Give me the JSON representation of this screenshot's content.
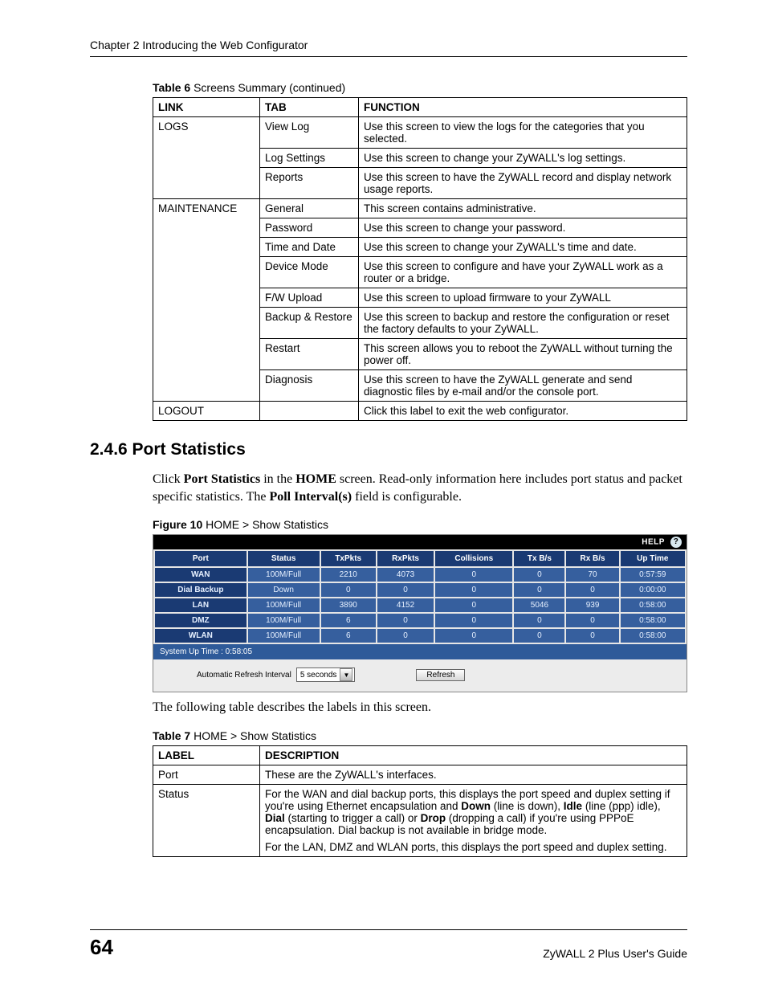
{
  "header": {
    "chapter": "Chapter 2 Introducing the Web Configurator"
  },
  "table6": {
    "caption_bold": "Table 6",
    "caption_rest": "   Screens Summary (continued)",
    "headers": {
      "link": "LINK",
      "tab": "TAB",
      "function": "FUNCTION"
    },
    "groups": [
      {
        "link": "LOGS",
        "rows": [
          {
            "tab": "View Log",
            "fn": "Use this screen to view the logs for the categories that you selected."
          },
          {
            "tab": "Log Settings",
            "fn": "Use this screen to change your ZyWALL's log settings."
          },
          {
            "tab": "Reports",
            "fn": "Use this screen to have the ZyWALL record and display network usage reports."
          }
        ]
      },
      {
        "link": "MAINTENANCE",
        "rows": [
          {
            "tab": "General",
            "fn": "This screen contains administrative."
          },
          {
            "tab": "Password",
            "fn": "Use this screen to change your password."
          },
          {
            "tab": "Time and Date",
            "fn": "Use this screen to change your ZyWALL's time and date."
          },
          {
            "tab": "Device Mode",
            "fn": "Use this screen to configure and have your ZyWALL work as a router or a bridge."
          },
          {
            "tab": "F/W Upload",
            "fn": "Use this screen to upload firmware to your ZyWALL"
          },
          {
            "tab": "Backup & Restore",
            "fn": "Use this screen to backup and restore the configuration or reset the factory defaults to your ZyWALL."
          },
          {
            "tab": "Restart",
            "fn": "This screen allows you to reboot the ZyWALL without turning the power off."
          },
          {
            "tab": "Diagnosis",
            "fn": "Use this screen to have the ZyWALL generate and send diagnostic files by e-mail and/or the console port."
          }
        ]
      },
      {
        "link": "LOGOUT",
        "rows": [
          {
            "tab": "",
            "fn": "Click this label to exit the web configurator."
          }
        ]
      }
    ]
  },
  "section": {
    "heading": "2.4.6  Port Statistics",
    "para_parts": {
      "p1": "Click ",
      "b1": "Port Statistics",
      "p2": " in the ",
      "b2": "HOME",
      "p3": " screen. Read-only information here includes port status and packet specific statistics. The ",
      "b3": "Poll Interval(s)",
      "p4": " field is configurable."
    }
  },
  "figure10": {
    "caption_bold": "Figure 10",
    "caption_rest": "   HOME > Show Statistics",
    "help_label": "HELP",
    "headers": [
      "Port",
      "Status",
      "TxPkts",
      "RxPkts",
      "Collisions",
      "Tx B/s",
      "Rx B/s",
      "Up Time"
    ],
    "rows": [
      [
        "WAN",
        "100M/Full",
        "2210",
        "4073",
        "0",
        "0",
        "70",
        "0:57:59"
      ],
      [
        "Dial Backup",
        "Down",
        "0",
        "0",
        "0",
        "0",
        "0",
        "0:00:00"
      ],
      [
        "LAN",
        "100M/Full",
        "3890",
        "4152",
        "0",
        "5046",
        "939",
        "0:58:00"
      ],
      [
        "DMZ",
        "100M/Full",
        "6",
        "0",
        "0",
        "0",
        "0",
        "0:58:00"
      ],
      [
        "WLAN",
        "100M/Full",
        "6",
        "0",
        "0",
        "0",
        "0",
        "0:58:00"
      ]
    ],
    "system_uptime": "System Up Time : 0:58:05",
    "refresh_label": "Automatic Refresh Interval",
    "refresh_value": "5 seconds",
    "refresh_button": "Refresh"
  },
  "after_figure_para": "The following table describes the labels in this screen.",
  "table7": {
    "caption_bold": "Table 7",
    "caption_rest": "   HOME > Show Statistics",
    "headers": {
      "label": "LABEL",
      "desc": "DESCRIPTION"
    },
    "rows": [
      {
        "label": "Port",
        "desc_plain": "These are the ZyWALL's interfaces."
      },
      {
        "label": "Status",
        "desc_parts": {
          "a": "For the WAN and dial backup ports, this displays the port speed and duplex setting if you're using Ethernet encapsulation and ",
          "b1": "Down",
          "c": " (line is down), ",
          "b2": "Idle",
          "d": " (line (ppp) idle), ",
          "b3": "Dial",
          "e": " (starting to trigger a call) or ",
          "b4": "Drop",
          "f": " (dropping a call) if you're using PPPoE encapsulation. Dial backup is not available in bridge mode.",
          "g": "For the LAN, DMZ and WLAN ports, this displays the port speed and duplex setting."
        }
      }
    ]
  },
  "chart_data": {
    "type": "table",
    "title": "HOME > Show Statistics",
    "columns": [
      "Port",
      "Status",
      "TxPkts",
      "RxPkts",
      "Collisions",
      "Tx B/s",
      "Rx B/s",
      "Up Time"
    ],
    "rows": [
      [
        "WAN",
        "100M/Full",
        2210,
        4073,
        0,
        0,
        70,
        "0:57:59"
      ],
      [
        "Dial Backup",
        "Down",
        0,
        0,
        0,
        0,
        0,
        "0:00:00"
      ],
      [
        "LAN",
        "100M/Full",
        3890,
        4152,
        0,
        5046,
        939,
        "0:58:00"
      ],
      [
        "DMZ",
        "100M/Full",
        6,
        0,
        0,
        0,
        0,
        "0:58:00"
      ],
      [
        "WLAN",
        "100M/Full",
        6,
        0,
        0,
        0,
        0,
        "0:58:00"
      ]
    ],
    "system_uptime": "0:58:05"
  },
  "footer": {
    "page_number": "64",
    "doc_title": "ZyWALL 2 Plus User's Guide"
  }
}
